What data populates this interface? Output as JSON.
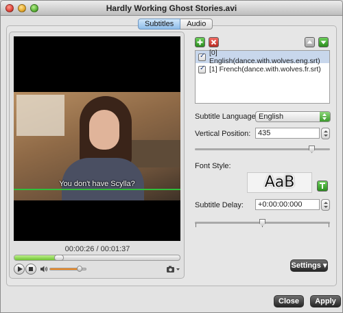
{
  "window": {
    "title": "Hardly Working  Ghost Stories.avi"
  },
  "tabs": [
    {
      "label": "Subtitles",
      "active": true
    },
    {
      "label": "Audio",
      "active": false
    }
  ],
  "player": {
    "subtitle_text": "You don't have Scylla?",
    "timecode": "00:00:26 / 00:01:37",
    "progress_fraction": 0.27,
    "volume_fraction": 0.82
  },
  "subtitle_list": {
    "items": [
      {
        "label": "[0] English(dance.with.wolves.eng.srt)",
        "checked": true,
        "selected": true
      },
      {
        "label": "[1] French(dance.with.wolves.fr.srt)",
        "checked": true,
        "selected": false
      }
    ]
  },
  "settings": {
    "language_label": "Subtitle Language:",
    "language_value": "English",
    "vertical_label": "Vertical Position:",
    "vertical_value": "435",
    "vertical_fraction": 0.87,
    "font_label": "Font Style:",
    "font_preview": "AaB",
    "delay_label": "Subtitle Delay:",
    "delay_value": "+0:00:00:000",
    "delay_fraction": 0.5
  },
  "buttons": {
    "settings": "Settings ▾",
    "close": "Close",
    "apply": "Apply"
  },
  "colors": {
    "accent_green": "#3b9a2c",
    "remove_red": "#b82b22",
    "selection_blue": "#c8d7ec",
    "volume_orange": "#f08a20"
  }
}
